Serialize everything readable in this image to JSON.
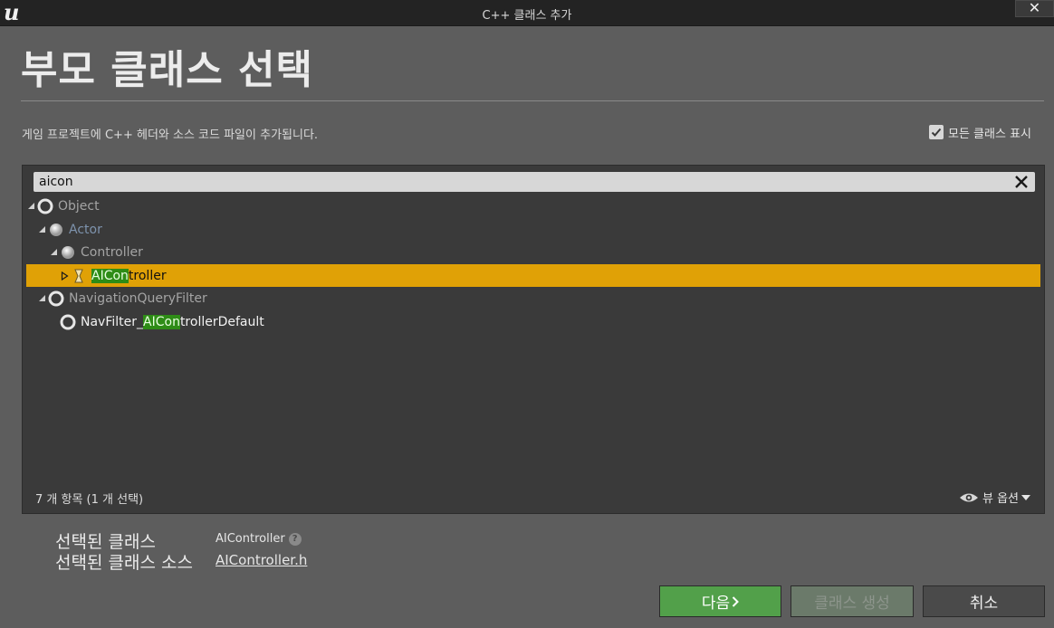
{
  "window": {
    "logo_icon": "unreal-engine-logo",
    "title": "C++ 클래스 추가",
    "close_label": "✕"
  },
  "header": {
    "heading": "부모 클래스 선택",
    "description": "게임 프로젝트에 C++ 헤더와 소스 코드 파일이 추가됩니다.",
    "show_all_label": "모든 클래스 표시",
    "show_all_checked": true
  },
  "search": {
    "value": "aicon",
    "clear_icon": "clear-x-icon"
  },
  "tree": [
    {
      "label": "Object",
      "indent": 0,
      "expanded": true,
      "icon": "circle-ring-icon",
      "style": "dim"
    },
    {
      "label": "Actor",
      "indent": 1,
      "expanded": true,
      "icon": "sphere-icon",
      "style": "blue"
    },
    {
      "label": "Controller",
      "indent": 2,
      "expanded": true,
      "icon": "sphere-icon",
      "style": "dim"
    },
    {
      "label_highlight": "AICon",
      "label_rest": "troller",
      "indent": 3,
      "expanded": false,
      "icon": "hourglass-icon",
      "style": "selected"
    },
    {
      "label": "NavigationQueryFilter",
      "indent": 1,
      "expanded": true,
      "icon": "circle-ring-icon",
      "style": "dim"
    },
    {
      "label_prefix": "NavFilter_",
      "label_highlight": "AICon",
      "label_rest": "trollerDefault",
      "indent": 2,
      "icon": "circle-ring-icon",
      "style": "white"
    }
  ],
  "footer": {
    "count_text": "7 개 항목 (1 개 선택)",
    "view_options_label": "뷰 옵션",
    "view_options_icon": "eye-icon"
  },
  "selection": {
    "class_label": "선택된 클래스",
    "class_value": "AIController",
    "source_label": "선택된 클래스 소스",
    "source_value": "AIController.h",
    "help_icon": "help-icon"
  },
  "buttons": {
    "next": "다음",
    "create": "클래스 생성",
    "cancel": "취소"
  },
  "colors": {
    "selection": "#e0a106",
    "match_highlight": "#2e8c16",
    "next_button": "#52a04a"
  }
}
